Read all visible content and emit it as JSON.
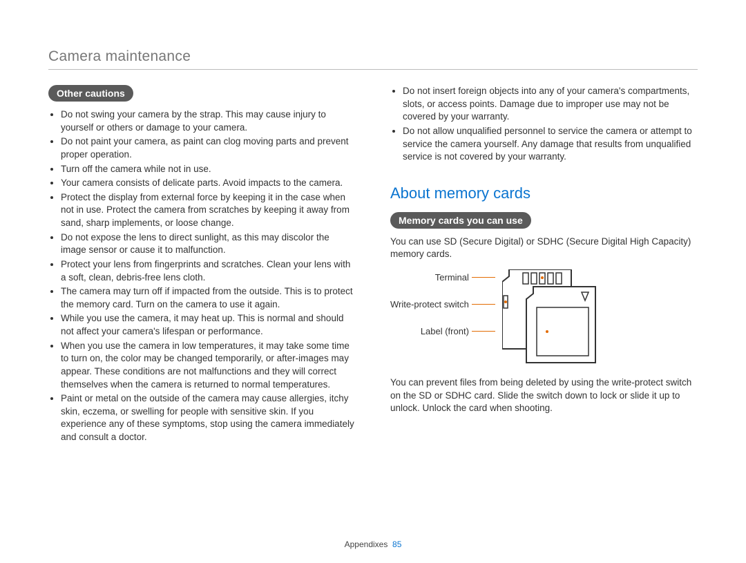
{
  "header": "Camera maintenance",
  "pill_other": "Other cautions",
  "left_bullets": [
    "Do not swing your camera by the strap. This may cause injury to yourself or others or damage to your camera.",
    "Do not paint your camera, as paint can clog moving parts and prevent proper operation.",
    "Turn off the camera while not in use.",
    "Your camera consists of delicate parts. Avoid impacts to the camera.",
    "Protect the display from external force by keeping it in the case when not in use. Protect the camera from scratches by keeping it away from sand, sharp implements, or loose change.",
    "Do not expose the lens to direct sunlight, as this may discolor the image sensor or cause it to malfunction.",
    "Protect your lens from fingerprints and scratches. Clean your lens with a soft, clean, debris-free lens cloth.",
    "The camera may turn off if impacted from the outside. This is to protect the memory card. Turn on the camera to use it again.",
    "While you use the camera, it may heat up. This is normal and should not affect your camera's lifespan or performance.",
    "When you use the camera in low temperatures, it may take some time to turn on, the color may be changed temporarily, or after-images may appear. These conditions are not malfunctions and they will correct themselves when the camera is returned to normal temperatures.",
    "Paint or metal on the outside of the camera may cause allergies, itchy skin, eczema, or swelling for people with sensitive skin. If you experience any of these symptoms, stop using the camera immediately and consult a doctor."
  ],
  "right_top_bullets": [
    "Do not insert foreign objects into any of your camera's compartments, slots, or access points. Damage due to improper use may not be covered by your warranty.",
    "Do not allow unqualified personnel to service the camera or attempt to service the camera yourself. Any damage that results from unqualified service is not covered by your warranty."
  ],
  "section_title": "About memory cards",
  "pill_memory": "Memory cards you can use",
  "memory_intro": "You can use SD (Secure Digital) or SDHC (Secure Digital High Capacity) memory cards.",
  "diagram": {
    "terminal": "Terminal",
    "wp": "Write-protect switch",
    "label": "Label (front)"
  },
  "memory_outro": "You can prevent files from being deleted by using the write-protect switch on the SD or SDHC card. Slide the switch down to lock or slide it up to unlock. Unlock the card when shooting.",
  "footer_label": "Appendixes",
  "footer_page": "85"
}
